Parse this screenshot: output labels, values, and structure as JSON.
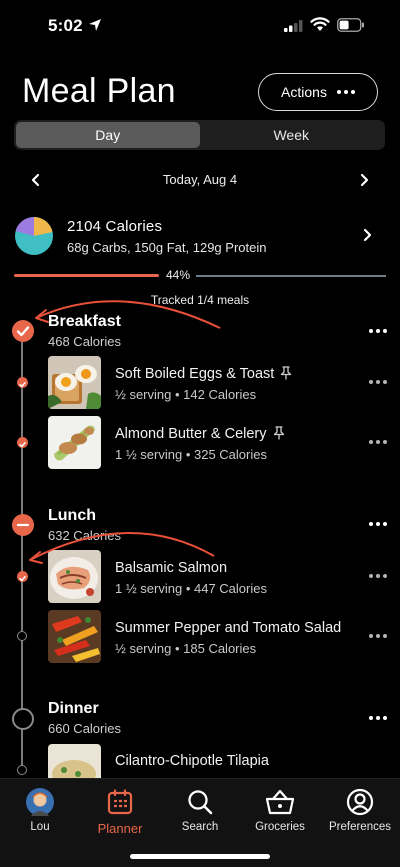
{
  "status": {
    "time": "5:02"
  },
  "header": {
    "title": "Meal Plan",
    "actions_label": "Actions"
  },
  "view_toggle": {
    "options": [
      "Day",
      "Week"
    ],
    "selected": "Day"
  },
  "date_nav": {
    "label": "Today, Aug 4"
  },
  "nutrition": {
    "calories": "2104 Calories",
    "macros": "68g Carbs, 150g Fat, 129g Protein",
    "pie_colors": {
      "carbs": "#9b7be0",
      "fat": "#3fbfc4",
      "protein": "#f0b84a"
    }
  },
  "progress": {
    "percent_label": "44%",
    "value": 0.44,
    "tracked_label": "Tracked 1/4 meals"
  },
  "meals": [
    {
      "name": "Breakfast",
      "calories": "468 Calories",
      "status": "complete",
      "items": [
        {
          "name": "Soft Boiled Eggs & Toast",
          "sub": "½ serving • 142 Calories",
          "pinned": true,
          "tracked": true
        },
        {
          "name": "Almond Butter & Celery",
          "sub": "1 ½ serving • 325 Calories",
          "pinned": true,
          "tracked": true
        }
      ]
    },
    {
      "name": "Lunch",
      "calories": "632 Calories",
      "status": "partial",
      "items": [
        {
          "name": "Balsamic Salmon",
          "sub": "1 ½ serving • 447 Calories",
          "pinned": false,
          "tracked": true
        },
        {
          "name": "Summer Pepper and Tomato Salad",
          "sub": "½ serving • 185 Calories",
          "pinned": false,
          "tracked": false
        }
      ]
    },
    {
      "name": "Dinner",
      "calories": "660 Calories",
      "status": "empty",
      "items": [
        {
          "name": "Cilantro-Chipotle Tilapia",
          "sub": "",
          "pinned": false,
          "tracked": false
        }
      ]
    }
  ],
  "tabs": [
    {
      "label": "Lou",
      "icon": "avatar-icon"
    },
    {
      "label": "Planner",
      "icon": "calendar-icon",
      "active": true
    },
    {
      "label": "Search",
      "icon": "search-icon"
    },
    {
      "label": "Groceries",
      "icon": "basket-icon"
    },
    {
      "label": "Preferences",
      "icon": "profile-icon"
    }
  ],
  "accent_color": "#e8664a"
}
